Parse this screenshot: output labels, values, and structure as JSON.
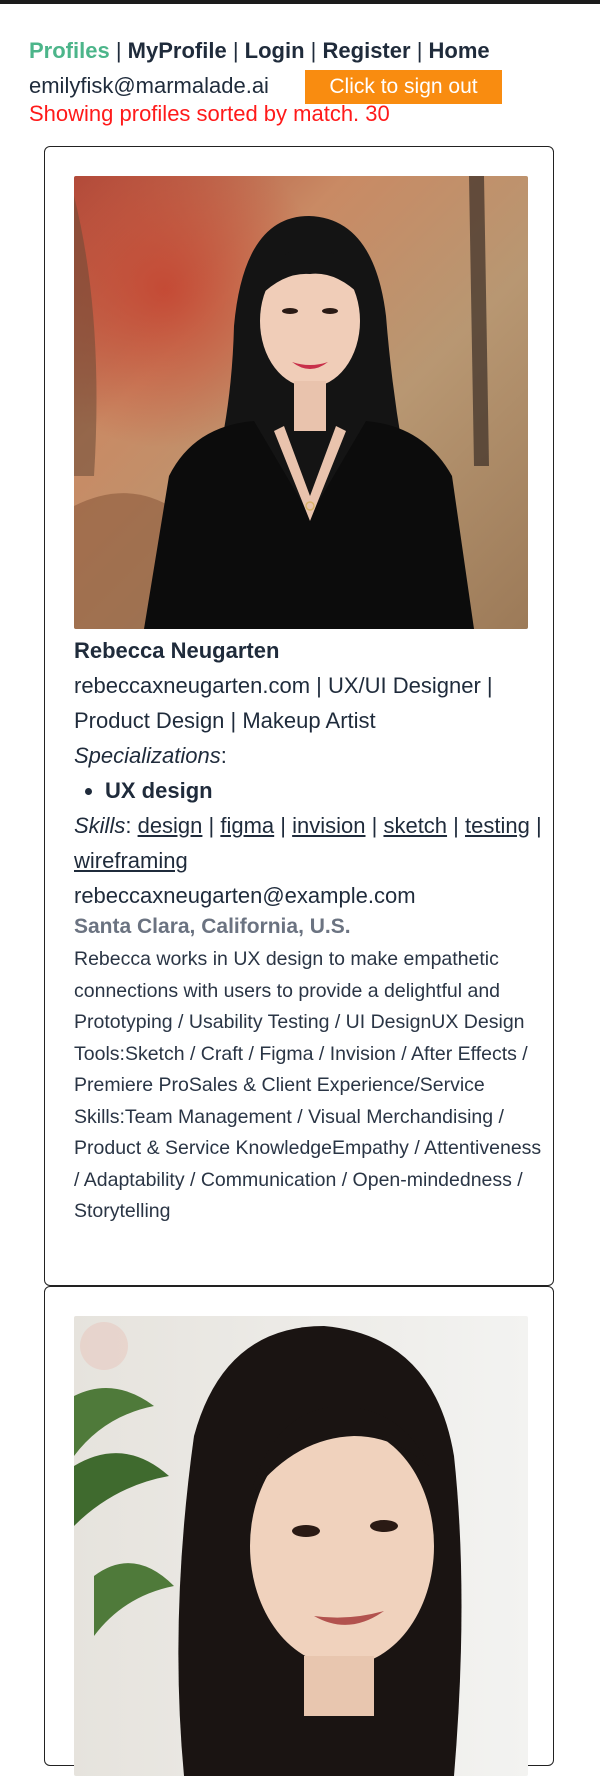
{
  "nav": {
    "items": [
      "Profiles",
      "MyProfile",
      "Login",
      "Register",
      "Home"
    ],
    "separator": "|"
  },
  "user": {
    "email": "emilyfisk@marmalade.ai"
  },
  "signout": {
    "label": "Click to sign out"
  },
  "status": "Showing profiles sorted by match. 30",
  "profiles": [
    {
      "name": "Rebecca Neugarten",
      "headline": "rebeccaxneugarten.com | UX/UI Designer | Product Design | Makeup Artist",
      "specializations_label": "Specializations",
      "specializations": [
        "UX design"
      ],
      "skills_label": "Skills",
      "skills": [
        "design",
        "figma",
        "invision",
        "sketch",
        "testing",
        "wireframing"
      ],
      "email": "rebeccaxneugarten@example.com",
      "location": "Santa Clara, California, U.S.",
      "bio": "Rebecca works in UX design to make empathetic connections with users to provide a delightful and Prototyping / Usability Testing / UI DesignUX Design Tools:Sketch / Craft / Figma / Invision / After Effects / Premiere ProSales & Client Experience/Service Skills:Team Management / Visual Merchandising / Product & Service KnowledgeEmpathy / Attentiveness / Adaptability / Communication / Open-mindedness / Storytelling"
    }
  ],
  "colors": {
    "accent": "#4cb58a",
    "button": "#f98c10",
    "status": "#ff1a1a",
    "text": "#1f2b3b",
    "location": "#6b7381"
  }
}
